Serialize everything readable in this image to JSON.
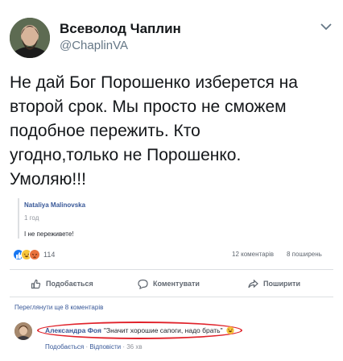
{
  "tweet": {
    "author_name": "Всеволод Чаплин",
    "author_handle": "@ChaplinVA",
    "text_lines": [
      "Не дай Бог Порошенко изберется на",
      "второй срок. Мы просто не сможем",
      "подобное пережить. Кто",
      "угодно,только не Порошенко.",
      "Умоляю!!!"
    ]
  },
  "quote": {
    "author": "Nataliya Malinovska",
    "time": "1 год",
    "text": "І не переживете!"
  },
  "stats": {
    "reactions_count": "114",
    "comments": "12 коментарів",
    "shares": "8 поширень",
    "reaction_icons": [
      "like-icon",
      "haha-icon",
      "angry-icon"
    ]
  },
  "actions": {
    "like": "Подобається",
    "comment": "Коментувати",
    "share": "Поширити"
  },
  "comments": {
    "more_label": "Переглянути ще 8 коментарів",
    "items": [
      {
        "author": "Александра Фоя",
        "text": "\"Значит хорошие сапоги, надо брать\"",
        "like": "Подобається",
        "reply": "Відповісти",
        "time": "36 хв"
      }
    ]
  },
  "colors": {
    "link": "#385898",
    "highlight": "#e0222a",
    "like": "#1877f2"
  }
}
